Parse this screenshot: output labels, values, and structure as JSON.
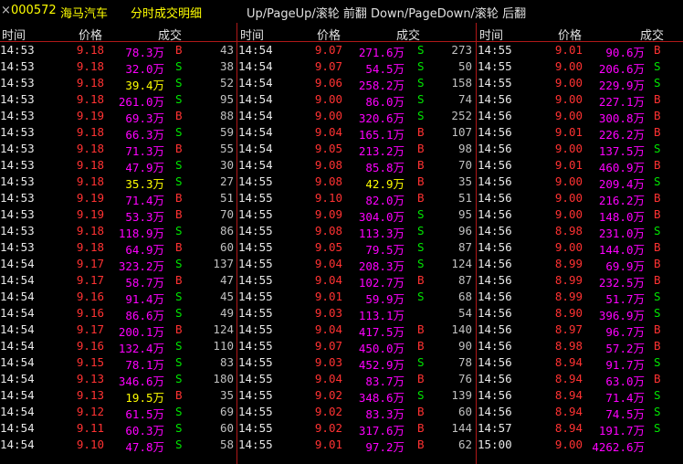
{
  "title": {
    "close": "×",
    "code": "000572",
    "name": "海马汽车",
    "window": "分时成交明细",
    "hint": "Up/PageUp/滚轮 前翻 Down/PageDown/滚轮 后翻"
  },
  "headers": {
    "time": "时间",
    "price": "价格",
    "deal": "成交"
  },
  "colors": {
    "up": "#ff3232",
    "down": "#00e600",
    "amount": "#ff00ff",
    "title": "#ffff00",
    "grid": "#b01818"
  },
  "columns": [
    {
      "rows": [
        {
          "time": "14:53",
          "price": "9.18",
          "amount": "78.3万",
          "dir": "B",
          "vol": "43"
        },
        {
          "time": "14:53",
          "price": "9.18",
          "amount": "32.0万",
          "dir": "S",
          "vol": "38"
        },
        {
          "time": "14:53",
          "price": "9.18",
          "amount": "39.4万",
          "dir": "S",
          "vol": "52"
        },
        {
          "time": "14:53",
          "price": "9.18",
          "amount": "261.0万",
          "dir": "S",
          "vol": "95"
        },
        {
          "time": "14:53",
          "price": "9.19",
          "amount": "69.3万",
          "dir": "B",
          "vol": "88"
        },
        {
          "time": "14:53",
          "price": "9.18",
          "amount": "66.3万",
          "dir": "S",
          "vol": "59"
        },
        {
          "time": "14:53",
          "price": "9.18",
          "amount": "71.3万",
          "dir": "B",
          "vol": "55"
        },
        {
          "time": "14:53",
          "price": "9.18",
          "amount": "47.9万",
          "dir": "S",
          "vol": "30"
        },
        {
          "time": "14:53",
          "price": "9.18",
          "amount": "35.3万",
          "dir": "S",
          "vol": "27"
        },
        {
          "time": "14:53",
          "price": "9.19",
          "amount": "71.4万",
          "dir": "B",
          "vol": "51"
        },
        {
          "time": "14:53",
          "price": "9.19",
          "amount": "53.3万",
          "dir": "B",
          "vol": "70"
        },
        {
          "time": "14:53",
          "price": "9.18",
          "amount": "118.9万",
          "dir": "S",
          "vol": "86"
        },
        {
          "time": "14:53",
          "price": "9.18",
          "amount": "64.9万",
          "dir": "B",
          "vol": "60"
        },
        {
          "time": "14:54",
          "price": "9.17",
          "amount": "323.2万",
          "dir": "S",
          "vol": "137"
        },
        {
          "time": "14:54",
          "price": "9.17",
          "amount": "58.7万",
          "dir": "B",
          "vol": "47"
        },
        {
          "time": "14:54",
          "price": "9.16",
          "amount": "91.4万",
          "dir": "S",
          "vol": "45"
        },
        {
          "time": "14:54",
          "price": "9.16",
          "amount": "86.6万",
          "dir": "S",
          "vol": "49"
        },
        {
          "time": "14:54",
          "price": "9.17",
          "amount": "200.1万",
          "dir": "B",
          "vol": "124"
        },
        {
          "time": "14:54",
          "price": "9.16",
          "amount": "132.4万",
          "dir": "S",
          "vol": "110"
        },
        {
          "time": "14:54",
          "price": "9.15",
          "amount": "78.1万",
          "dir": "S",
          "vol": "83"
        },
        {
          "time": "14:54",
          "price": "9.13",
          "amount": "346.6万",
          "dir": "S",
          "vol": "180"
        },
        {
          "time": "14:54",
          "price": "9.13",
          "amount": "19.5万",
          "dir": "B",
          "vol": "35"
        },
        {
          "time": "14:54",
          "price": "9.12",
          "amount": "61.5万",
          "dir": "S",
          "vol": "69"
        },
        {
          "time": "14:54",
          "price": "9.11",
          "amount": "60.3万",
          "dir": "S",
          "vol": "60"
        },
        {
          "time": "14:54",
          "price": "9.10",
          "amount": "47.8万",
          "dir": "S",
          "vol": "58"
        }
      ]
    },
    {
      "rows": [
        {
          "time": "14:54",
          "price": "9.07",
          "amount": "271.6万",
          "dir": "S",
          "vol": "273"
        },
        {
          "time": "14:54",
          "price": "9.07",
          "amount": "54.5万",
          "dir": "S",
          "vol": "50"
        },
        {
          "time": "14:54",
          "price": "9.06",
          "amount": "258.2万",
          "dir": "S",
          "vol": "158"
        },
        {
          "time": "14:54",
          "price": "9.00",
          "amount": "86.0万",
          "dir": "S",
          "vol": "74"
        },
        {
          "time": "14:54",
          "price": "9.00",
          "amount": "320.6万",
          "dir": "S",
          "vol": "252"
        },
        {
          "time": "14:54",
          "price": "9.04",
          "amount": "165.1万",
          "dir": "B",
          "vol": "107"
        },
        {
          "time": "14:54",
          "price": "9.05",
          "amount": "213.2万",
          "dir": "B",
          "vol": "98"
        },
        {
          "time": "14:54",
          "price": "9.08",
          "amount": "85.8万",
          "dir": "B",
          "vol": "70"
        },
        {
          "time": "14:55",
          "price": "9.08",
          "amount": "42.9万",
          "dir": "B",
          "vol": "35"
        },
        {
          "time": "14:55",
          "price": "9.10",
          "amount": "82.0万",
          "dir": "B",
          "vol": "51"
        },
        {
          "time": "14:55",
          "price": "9.09",
          "amount": "304.0万",
          "dir": "S",
          "vol": "95"
        },
        {
          "time": "14:55",
          "price": "9.08",
          "amount": "113.3万",
          "dir": "S",
          "vol": "96"
        },
        {
          "time": "14:55",
          "price": "9.05",
          "amount": "79.5万",
          "dir": "S",
          "vol": "87"
        },
        {
          "time": "14:55",
          "price": "9.04",
          "amount": "208.3万",
          "dir": "S",
          "vol": "124"
        },
        {
          "time": "14:55",
          "price": "9.04",
          "amount": "102.7万",
          "dir": "B",
          "vol": "87"
        },
        {
          "time": "14:55",
          "price": "9.01",
          "amount": "59.9万",
          "dir": "S",
          "vol": "68"
        },
        {
          "time": "14:55",
          "price": "9.03",
          "amount": "113.1万",
          "dir": "",
          "vol": "54"
        },
        {
          "time": "14:55",
          "price": "9.04",
          "amount": "417.5万",
          "dir": "B",
          "vol": "140"
        },
        {
          "time": "14:55",
          "price": "9.07",
          "amount": "450.0万",
          "dir": "B",
          "vol": "90"
        },
        {
          "time": "14:55",
          "price": "9.03",
          "amount": "452.9万",
          "dir": "S",
          "vol": "78"
        },
        {
          "time": "14:55",
          "price": "9.04",
          "amount": "83.7万",
          "dir": "B",
          "vol": "76"
        },
        {
          "time": "14:55",
          "price": "9.02",
          "amount": "348.6万",
          "dir": "S",
          "vol": "139"
        },
        {
          "time": "14:55",
          "price": "9.02",
          "amount": "83.3万",
          "dir": "B",
          "vol": "60"
        },
        {
          "time": "14:55",
          "price": "9.02",
          "amount": "317.6万",
          "dir": "B",
          "vol": "144"
        },
        {
          "time": "14:55",
          "price": "9.01",
          "amount": "97.2万",
          "dir": "B",
          "vol": "62"
        }
      ]
    },
    {
      "rows": [
        {
          "time": "14:55",
          "price": "9.01",
          "amount": "90.6万",
          "dir": "B",
          "vol": ""
        },
        {
          "time": "14:55",
          "price": "9.00",
          "amount": "206.6万",
          "dir": "S",
          "vol": ""
        },
        {
          "time": "14:55",
          "price": "9.00",
          "amount": "229.9万",
          "dir": "S",
          "vol": ""
        },
        {
          "time": "14:56",
          "price": "9.00",
          "amount": "227.1万",
          "dir": "B",
          "vol": ""
        },
        {
          "time": "14:56",
          "price": "9.00",
          "amount": "300.8万",
          "dir": "B",
          "vol": ""
        },
        {
          "time": "14:56",
          "price": "9.01",
          "amount": "226.2万",
          "dir": "B",
          "vol": ""
        },
        {
          "time": "14:56",
          "price": "9.00",
          "amount": "137.5万",
          "dir": "S",
          "vol": ""
        },
        {
          "time": "14:56",
          "price": "9.01",
          "amount": "460.9万",
          "dir": "B",
          "vol": ""
        },
        {
          "time": "14:56",
          "price": "9.00",
          "amount": "209.4万",
          "dir": "S",
          "vol": ""
        },
        {
          "time": "14:56",
          "price": "9.00",
          "amount": "216.2万",
          "dir": "B",
          "vol": ""
        },
        {
          "time": "14:56",
          "price": "9.00",
          "amount": "148.0万",
          "dir": "B",
          "vol": ""
        },
        {
          "time": "14:56",
          "price": "8.98",
          "amount": "231.0万",
          "dir": "S",
          "vol": ""
        },
        {
          "time": "14:56",
          "price": "9.00",
          "amount": "144.0万",
          "dir": "B",
          "vol": ""
        },
        {
          "time": "14:56",
          "price": "8.99",
          "amount": "69.9万",
          "dir": "B",
          "vol": ""
        },
        {
          "time": "14:56",
          "price": "8.99",
          "amount": "232.5万",
          "dir": "B",
          "vol": ""
        },
        {
          "time": "14:56",
          "price": "8.99",
          "amount": "51.7万",
          "dir": "S",
          "vol": ""
        },
        {
          "time": "14:56",
          "price": "8.90",
          "amount": "396.9万",
          "dir": "S",
          "vol": ""
        },
        {
          "time": "14:56",
          "price": "8.97",
          "amount": "96.7万",
          "dir": "B",
          "vol": ""
        },
        {
          "time": "14:56",
          "price": "8.98",
          "amount": "57.2万",
          "dir": "B",
          "vol": ""
        },
        {
          "time": "14:56",
          "price": "8.94",
          "amount": "91.7万",
          "dir": "S",
          "vol": ""
        },
        {
          "time": "14:56",
          "price": "8.94",
          "amount": "63.0万",
          "dir": "B",
          "vol": ""
        },
        {
          "time": "14:56",
          "price": "8.94",
          "amount": "71.4万",
          "dir": "S",
          "vol": ""
        },
        {
          "time": "14:56",
          "price": "8.94",
          "amount": "74.5万",
          "dir": "S",
          "vol": ""
        },
        {
          "time": "14:57",
          "price": "8.94",
          "amount": "191.7万",
          "dir": "S",
          "vol": ""
        },
        {
          "time": "15:00",
          "price": "9.00",
          "amount": "4262.6万",
          "dir": "",
          "vol": ""
        }
      ]
    }
  ]
}
